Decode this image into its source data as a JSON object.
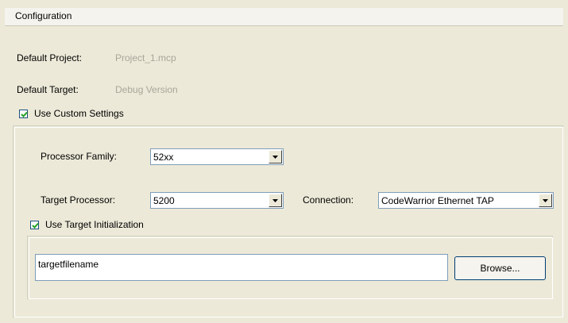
{
  "header": {
    "title": "Configuration"
  },
  "default_project": {
    "label": "Default Project:",
    "value": "Project_1.mcp"
  },
  "default_target": {
    "label": "Default Target:",
    "value": "Debug Version"
  },
  "use_custom_settings": {
    "label": "Use Custom Settings",
    "checked": true
  },
  "processor_family": {
    "label": "Processor Family:",
    "value": "52xx"
  },
  "target_processor": {
    "label": "Target Processor:",
    "value": "5200"
  },
  "connection": {
    "label": "Connection:",
    "value": "CodeWarrior Ethernet TAP"
  },
  "use_target_init": {
    "label": "Use Target Initialization",
    "checked": true
  },
  "init_file": {
    "value": "targetfilename"
  },
  "browse": {
    "label": "Browse..."
  },
  "icons": {
    "checkbox_check": "checkmark-icon",
    "dropdown_arrow": "chevron-down-icon"
  }
}
